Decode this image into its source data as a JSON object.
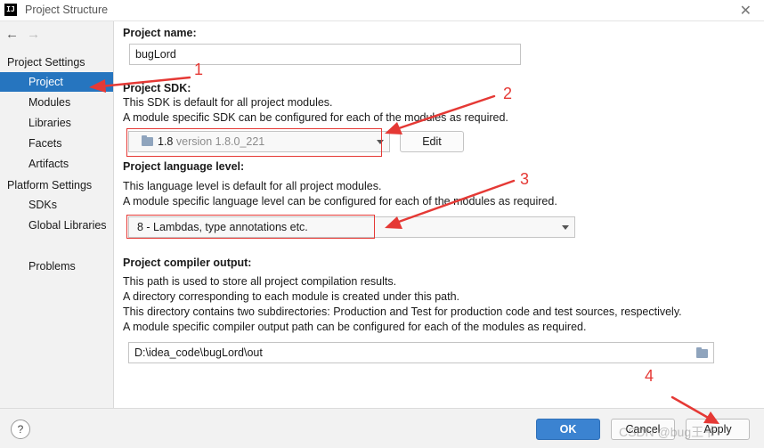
{
  "window": {
    "icon_text": "IJ",
    "title": "Project Structure",
    "close_glyph": "✕"
  },
  "nav": {
    "back": "←",
    "forward": "→"
  },
  "sidebar": {
    "groups": [
      {
        "label": "Project Settings"
      },
      {
        "label": "Platform Settings"
      }
    ],
    "items": [
      {
        "label": "Project",
        "selected": true
      },
      {
        "label": "Modules"
      },
      {
        "label": "Libraries"
      },
      {
        "label": "Facets"
      },
      {
        "label": "Artifacts"
      },
      {
        "label": "SDKs"
      },
      {
        "label": "Global Libraries"
      },
      {
        "label": "Problems"
      }
    ]
  },
  "project_name": {
    "label": "Project name:",
    "value": "bugLord"
  },
  "project_sdk": {
    "label": "Project SDK:",
    "desc1": "This SDK is default for all project modules.",
    "desc2": "A module specific SDK can be configured for each of the modules as required.",
    "value": "1.8",
    "value_detail": "version 1.8.0_221",
    "edit_button": "Edit"
  },
  "language_level": {
    "label": "Project language level:",
    "desc1": "This language level is default for all project modules.",
    "desc2": "A module specific language level can be configured for each of the modules as required.",
    "value": "8 - Lambdas, type annotations etc."
  },
  "compiler_output": {
    "label": "Project compiler output:",
    "desc1": "This path is used to store all project compilation results.",
    "desc2": "A directory corresponding to each module is created under this path.",
    "desc3": "This directory contains two subdirectories: Production and Test for production code and test sources, respectively.",
    "desc4": "A module specific compiler output path can be configured for each of the modules as required.",
    "value": "D:\\idea_code\\bugLord\\out"
  },
  "footer": {
    "help": "?",
    "ok": "OK",
    "cancel": "Cancel",
    "apply": "Apply"
  },
  "watermark": "CSDN @bug王爷",
  "annotations": {
    "a1": "1",
    "a2": "2",
    "a3": "3",
    "a4": "4",
    "color": "#e53935"
  },
  "colors": {
    "selection": "#2675bf",
    "ok_button": "#3b83d1"
  }
}
